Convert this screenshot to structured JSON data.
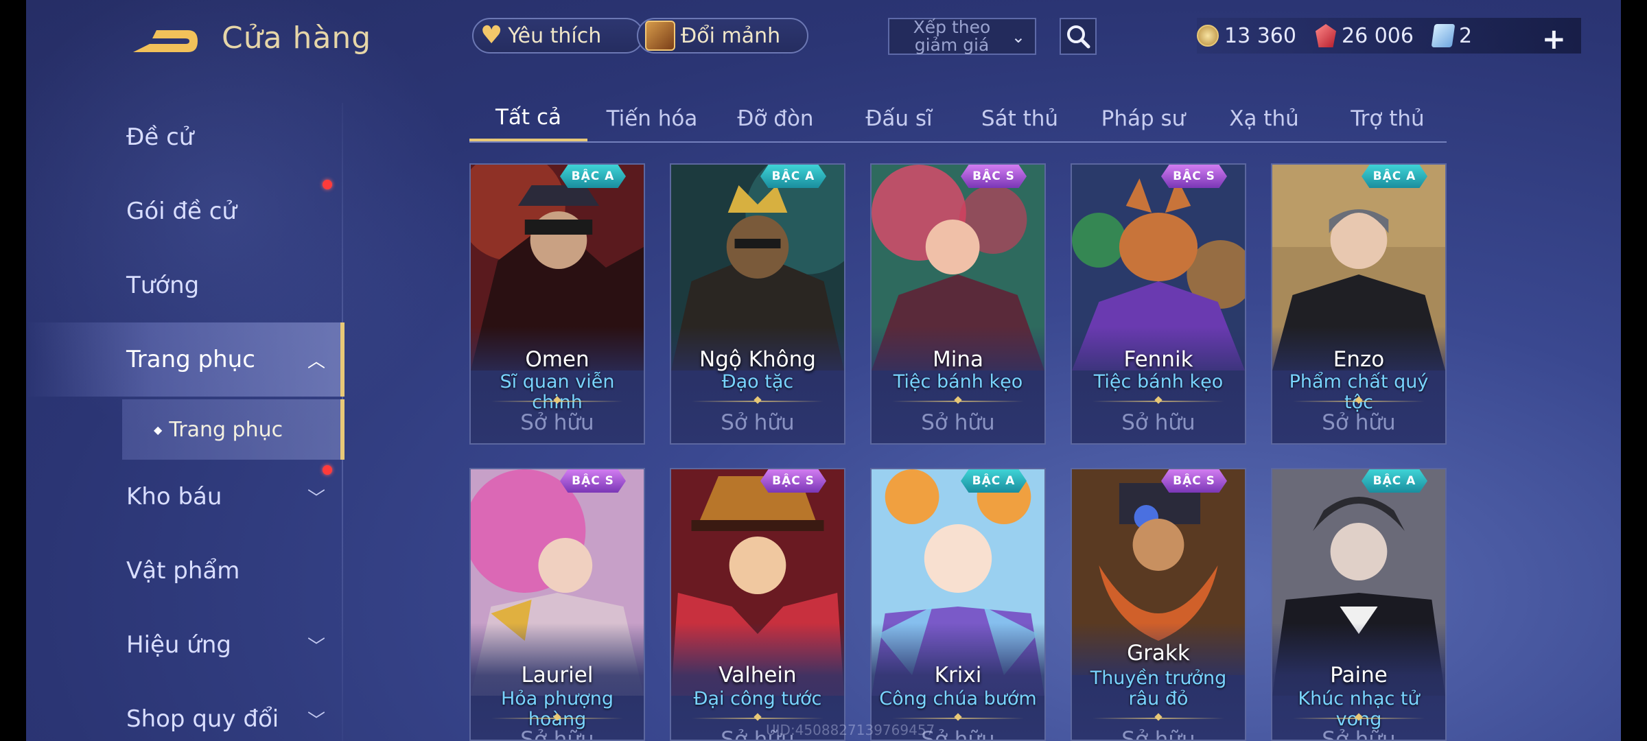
{
  "header": {
    "title": "Cửa hàng",
    "favorite_label": "Yêu thích",
    "exchange_label": "Đổi mảnh",
    "sort_label": "Xếp theo giảm giá",
    "currencies": [
      {
        "icon": "gold-coin-icon",
        "value": "13 360"
      },
      {
        "icon": "ruby-icon",
        "value": "26 006"
      },
      {
        "icon": "voucher-icon",
        "value": "2"
      }
    ]
  },
  "sidebar": {
    "items": [
      {
        "label": "Đề cử"
      },
      {
        "label": "Gói đề cử"
      },
      {
        "label": "Tướng"
      },
      {
        "label": "Trang phục"
      },
      {
        "label": "Kho báu"
      },
      {
        "label": "Vật phẩm"
      },
      {
        "label": "Hiệu ứng"
      },
      {
        "label": "Shop quy đổi"
      }
    ],
    "sub_item": "Trang phục"
  },
  "tabs": [
    "Tất cả",
    "Tiến hóa",
    "Đỡ đòn",
    "Đấu sĩ",
    "Sát thủ",
    "Pháp sư",
    "Xạ thủ",
    "Trợ thủ"
  ],
  "cards": [
    {
      "hero": "Omen",
      "skin": "Sĩ quan viễn chinh",
      "rank": "BẬC A",
      "status": "Sở hữu"
    },
    {
      "hero": "Ngộ Không",
      "skin": "Đạo tặc",
      "rank": "BẬC A",
      "status": "Sở hữu"
    },
    {
      "hero": "Mina",
      "skin": "Tiệc bánh kẹo",
      "rank": "BẬC S",
      "status": "Sở hữu"
    },
    {
      "hero": "Fennik",
      "skin": "Tiệc bánh kẹo",
      "rank": "BẬC S",
      "status": "Sở hữu"
    },
    {
      "hero": "Enzo",
      "skin": "Phẩm chất quý tộc",
      "rank": "BẬC A",
      "status": "Sở hữu"
    },
    {
      "hero": "Lauriel",
      "skin": "Hỏa phượng hoàng",
      "rank": "BẬC S",
      "status": "Sở hữu"
    },
    {
      "hero": "Valhein",
      "skin": "Đại công tước",
      "rank": "BẬC S",
      "status": "Sở hữu"
    },
    {
      "hero": "Krixi",
      "skin": "Công chúa bướm",
      "rank": "BẬC A",
      "status": "Sở hữu"
    },
    {
      "hero": "Grakk",
      "skin": "Thuyền trưởng râu đỏ",
      "rank": "BẬC S",
      "status": "Sở hữu"
    },
    {
      "hero": "Paine",
      "skin": "Khúc nhạc tử vong",
      "rank": "BẬC A",
      "status": "Sở hữu"
    }
  ],
  "watermark": "UID:4508827139769457",
  "colors": {
    "accent_gold": "#e8c877",
    "skin_name": "#79d4ff",
    "rank_a": "#2bb7bf",
    "rank_s": "#a052d6"
  }
}
